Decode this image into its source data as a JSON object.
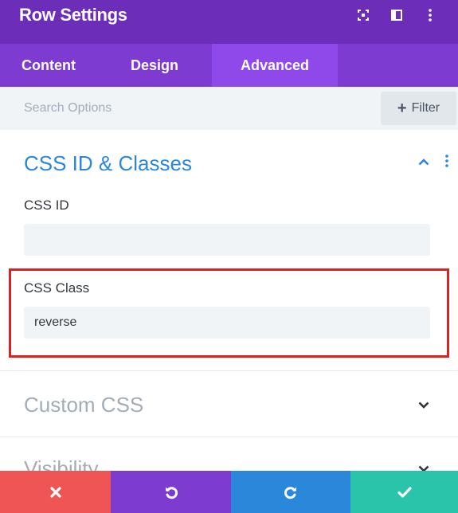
{
  "header": {
    "title": "Row Settings",
    "icons": [
      "expand-icon",
      "split-view-icon",
      "more-vertical-icon"
    ]
  },
  "tabs": [
    {
      "label": "Content",
      "active": false
    },
    {
      "label": "Design",
      "active": false
    },
    {
      "label": "Advanced",
      "active": true
    }
  ],
  "search": {
    "placeholder": "Search Options",
    "value": "",
    "filter_label": "Filter"
  },
  "sections": {
    "css_id_classes": {
      "title": "CSS ID & Classes",
      "expanded": true,
      "fields": {
        "css_id": {
          "label": "CSS ID",
          "value": ""
        },
        "css_class": {
          "label": "CSS Class",
          "value": "reverse"
        }
      }
    },
    "custom_css": {
      "title": "Custom CSS",
      "expanded": false
    },
    "visibility": {
      "title": "Visibility",
      "expanded": false
    }
  },
  "footer": {
    "buttons": [
      "close-icon",
      "undo-icon",
      "redo-icon",
      "check-icon"
    ]
  },
  "colors": {
    "header_bg": "#6c2eb9",
    "tabs_bg": "#7d3bd2",
    "active_tab_bg": "#8f48ea",
    "accent_blue": "#2b87da",
    "highlight_border": "#e02020",
    "cancel": "#ef5555",
    "undo": "#7e3bd0",
    "redo": "#2b87da",
    "save": "#29c4a9"
  }
}
